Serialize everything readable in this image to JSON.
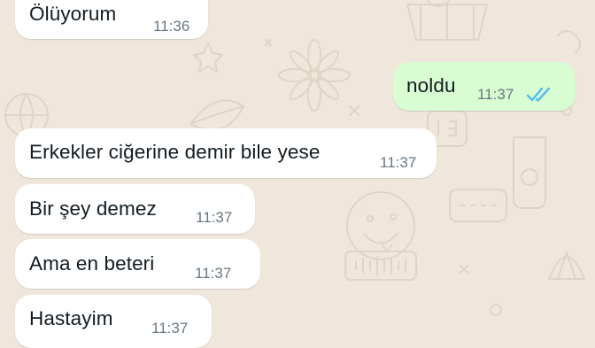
{
  "colors": {
    "wallpaper": "#efe7dc",
    "incoming_bubble": "#ffffff",
    "outgoing_bubble": "#d9fdd3",
    "read_ticks": "#53bdeb",
    "time_text": "#667781"
  },
  "messages": [
    {
      "direction": "incoming",
      "text": "Ölüyorum",
      "time": "11:36"
    },
    {
      "direction": "outgoing",
      "text": "noldu",
      "time": "11:37",
      "status_icon": "double-check-read-icon"
    },
    {
      "direction": "incoming",
      "text": "Erkekler ciğerine demir bile yese",
      "time": "11:37"
    },
    {
      "direction": "incoming",
      "text": "Bir şey demez",
      "time": "11:37"
    },
    {
      "direction": "incoming",
      "text": "Ama en beteri",
      "time": "11:37"
    },
    {
      "direction": "incoming",
      "text": "Hastayim",
      "time": "11:37"
    }
  ]
}
